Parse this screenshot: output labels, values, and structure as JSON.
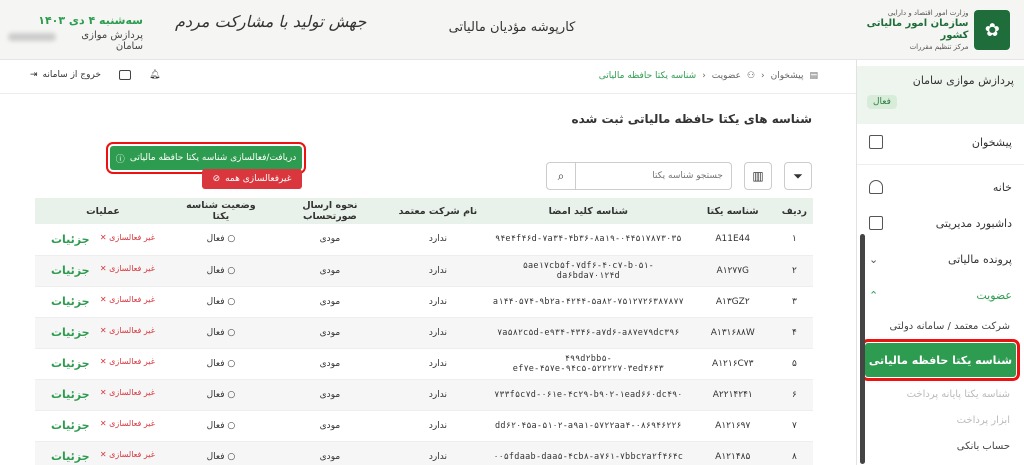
{
  "header": {
    "org_line1": "وزارت امور اقتصاد و دارایی",
    "org_line2": "سازمان امور مالیاتی کشور",
    "org_line3": "مرکز تنظیم مقررات",
    "title": "کارپوشه مؤدیان مالیاتی",
    "slogan": "جهش تولید با مشارکت مردم",
    "date": "سه‌شنبه ۴ دی ۱۴۰۳",
    "user_name": "پردازش موازی سامان"
  },
  "sidebar": {
    "user_name": "پردازش موازی سامان",
    "user_status": "فعال",
    "items": [
      {
        "label": "پیشخوان"
      },
      {
        "label": "خانه"
      },
      {
        "label": "داشبورد مدیریتی"
      },
      {
        "label": "پرونده مالیاتی"
      },
      {
        "label": "عضویت"
      }
    ],
    "sub_items": [
      {
        "label": "شرکت معتمد / سامانه دولتی"
      },
      {
        "label": "شناسه یکتا حافظه مالیاتی"
      },
      {
        "label": "شناسه یکتا پایانه پرداخت"
      },
      {
        "label": "ابزار پرداخت"
      },
      {
        "label": "حساب بانکی"
      }
    ]
  },
  "breadcrumb": {
    "home": "پیشخوان",
    "parent": "عضویت",
    "current": "شناسه یکتا حافظه مالیاتی"
  },
  "toolbar": {
    "logout": "خروج از سامانه"
  },
  "page": {
    "title": "شناسه های یکتا حافظه مالیاتی ثبت شده",
    "activate_button": "دریافت/فعالسازی شناسه یکتا حافظه مالیاتی",
    "deactivate_all_button": "غیرفعالسازی همه",
    "search_placeholder": "جستجو شناسه یکتا"
  },
  "table": {
    "headers": [
      "ردیف",
      "شناسه یکتا",
      "شناسه کلید امضا",
      "نام شرکت معتمد",
      "نحوه ارسال صورتحساب",
      "وضعیت شناسه یکتا",
      "عملیات"
    ],
    "rows": [
      {
        "idx": "۱",
        "uid": "A11E44",
        "key": "۹۴e۴f۴۶d-۷a۳۴-۴b۳۶-۸a۱۹-۰۴۴۵۱۷۸۷۳۰۳۵",
        "company": "ندارد",
        "send": "مودی",
        "status": "فعال",
        "deact": "غیر فعالسازی",
        "details": "جزئیات"
      },
      {
        "idx": "۲",
        "uid": "A۱۲۷۷G",
        "key": "۵ae۱۷cb۵f-۷df۶-۴۰c۷-b۰۵۱-da۶bda۷۰۱۲۴d",
        "company": "ندارد",
        "send": "مودی",
        "status": "فعال",
        "deact": "غیر فعالسازی",
        "details": "جزئیات"
      },
      {
        "idx": "۳",
        "uid": "A۱۳GZ۲",
        "key": "a۱۴۴۰۵۷۴-۹b۲a-۴۲۴۴-۵a۸۲-۷۵۱۲۷۲۶۳۸۷۸۷۷",
        "company": "ندارد",
        "send": "مودی",
        "status": "فعال",
        "deact": "غیر فعالسازی",
        "details": "جزئیات"
      },
      {
        "idx": "۴",
        "uid": "A۱۳۱۶۸۸W",
        "key": "۷a۵۸۲c۵d-e۹۳۴-۴۳۴۶-a۷d۶-a۸۷e۷۹dc۳۹۶",
        "company": "ندارد",
        "send": "مودی",
        "status": "فعال",
        "deact": "غیر فعالسازی",
        "details": "جزئیات"
      },
      {
        "idx": "۵",
        "uid": "A۱۲۱۶C۷۳",
        "key": "۴۹۹d۲bb۵-ef۷e-۴۵۷e-۹۴c۵-۵۲۲۲۲۷۰۳ed۴۶۴۳",
        "company": "ندارد",
        "send": "مودی",
        "status": "فعال",
        "deact": "غیر فعالسازی",
        "details": "جزئیات"
      },
      {
        "idx": "۶",
        "uid": "A۲۲۱۴۲۴۱",
        "key": "۷۳۳f۵c۷d-۰۶۱e-۴c۲۹-b۹۰۲-۱ead۶۶۰dc۴۹۰",
        "company": "ندارد",
        "send": "مودی",
        "status": "فعال",
        "deact": "غیر فعالسازی",
        "details": "جزئیات"
      },
      {
        "idx": "۷",
        "uid": "A۱۲۱۶۹۷",
        "key": "dd۶۲۰۴۵a-۵۱۰۲-a۹a۱-۵۷۲۲aa۴-۰۸۶۹۴۶۲۲۶",
        "company": "ندارد",
        "send": "مودی",
        "status": "فعال",
        "deact": "غیر فعالسازی",
        "details": "جزئیات"
      },
      {
        "idx": "۸",
        "uid": "A۱۲۱۴۸۵",
        "key": "۰۰۵fdaab-daa۵-۴cb۸-a۷۶۱-۷bbc۲a۲f۴۶۴c",
        "company": "ندارد",
        "send": "مودی",
        "status": "فعال",
        "deact": "غیر فعالسازی",
        "details": "جزئیات"
      }
    ]
  }
}
